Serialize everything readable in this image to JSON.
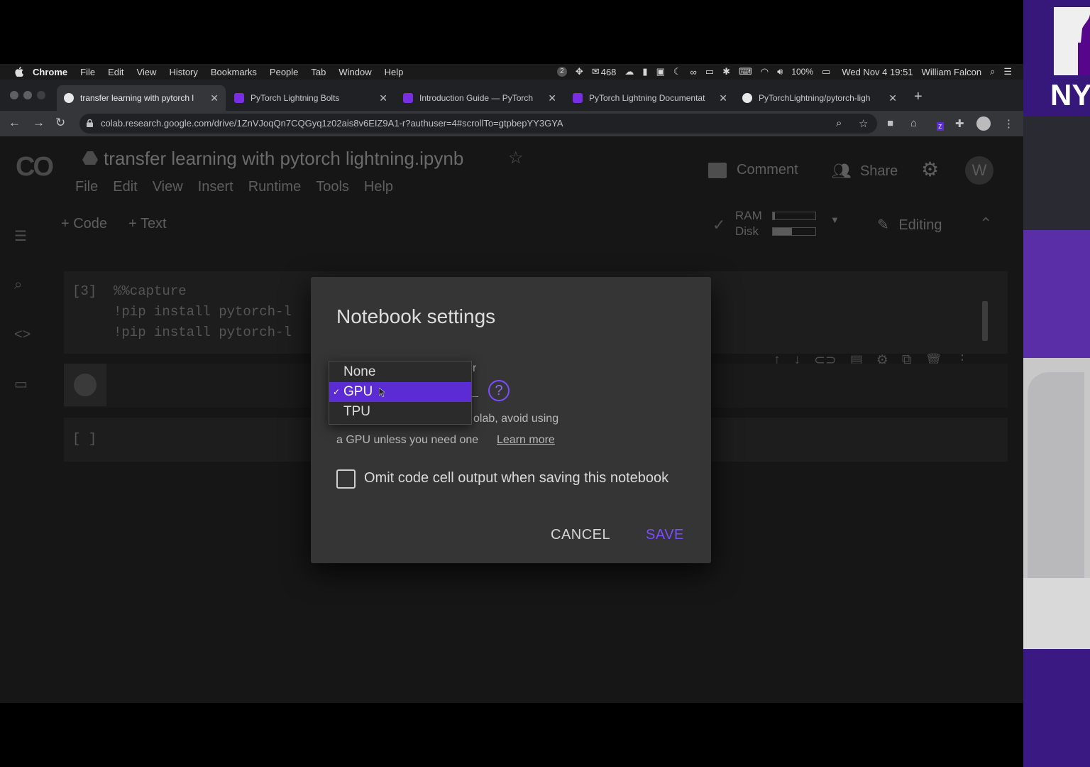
{
  "menubar": {
    "items": [
      "Chrome",
      "File",
      "Edit",
      "View",
      "History",
      "Bookmarks",
      "People",
      "Tab",
      "Window",
      "Help"
    ],
    "mail_count": "468",
    "battery": "100%",
    "datetime": "Wed Nov 4  19:51",
    "user": "William Falcon",
    "notif_count": "2"
  },
  "tabs": [
    {
      "title": "transfer learning with pytorch l",
      "favicon_color": "#e8e8e8",
      "active": true
    },
    {
      "title": "PyTorch Lightning Bolts",
      "favicon_color": "#792ee5"
    },
    {
      "title": "Introduction Guide — PyTorch",
      "favicon_color": "#792ee5"
    },
    {
      "title": "PyTorch Lightning Documentat",
      "favicon_color": "#792ee5"
    },
    {
      "title": "PyTorchLightning/pytorch-ligh",
      "favicon_color": "#e8e8e8"
    }
  ],
  "address_bar": {
    "url": "colab.research.google.com/drive/1ZnVJoqQn7CQGyq1z02ais8v6EIZ9A1-r?authuser=4#scrollTo=gtpbepYY3GYA"
  },
  "colab": {
    "logo": "CO",
    "notebook_title": "transfer learning with pytorch lightning.ipynb",
    "menu": [
      "File",
      "Edit",
      "View",
      "Insert",
      "Runtime",
      "Tools",
      "Help"
    ],
    "comment": "Comment",
    "share": "Share",
    "avatar": "W",
    "add_code": "+ Code",
    "add_text": "+ Text",
    "ram_label": "RAM",
    "disk_label": "Disk",
    "ram_fraction": 0.05,
    "disk_fraction": 0.45,
    "editing": "Editing",
    "cell1": {
      "prompt": "[3]",
      "lines": [
        "%%capture",
        "!pip install pytorch-l",
        "!pip install pytorch-l"
      ]
    },
    "cell3_prompt": "[ ]"
  },
  "dialog": {
    "title": "Notebook settings",
    "accel_tail": "r",
    "help": "?",
    "note1": "olab, avoid using",
    "note2": "a GPU unless you need one",
    "learn_more": "Learn more",
    "omit_label": "Omit code cell output when saving this notebook",
    "omit_checked": false,
    "cancel": "CANCEL",
    "save": "SAVE",
    "accent": "#7c4dff"
  },
  "dropdown": {
    "options": [
      "None",
      "GPU",
      "TPU"
    ],
    "selected": "GPU",
    "check": "✓",
    "highlight_color": "#5b2bd3"
  },
  "webcam": {
    "logo_text": "NY"
  }
}
